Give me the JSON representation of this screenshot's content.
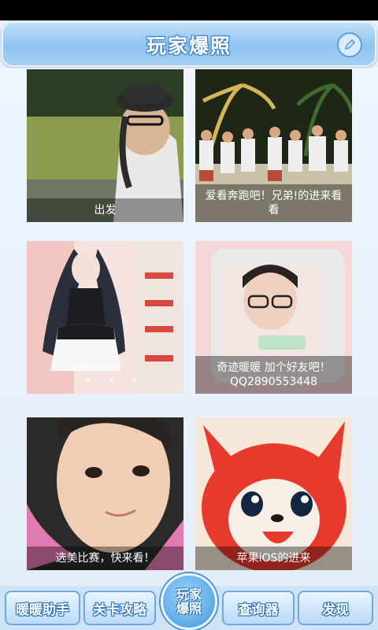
{
  "header": {
    "title": "玩家爆照"
  },
  "icons": {
    "edit": "pencil-icon"
  },
  "posts": [
    {
      "caption": "出发"
    },
    {
      "caption": "爱看奔跑吧！兄弟!的进来看看"
    },
    {
      "caption": ""
    },
    {
      "caption": "奇迹暖暖 加个好友吧！QQ2890553448"
    },
    {
      "caption": "选美比赛，快来看！"
    },
    {
      "caption": "苹果iOS的进来"
    }
  ],
  "tabs": [
    {
      "label": "暖暖助手"
    },
    {
      "label": "关卡攻略"
    },
    {
      "label": "玩家爆照"
    },
    {
      "label": "查询器"
    },
    {
      "label": "发现"
    }
  ]
}
